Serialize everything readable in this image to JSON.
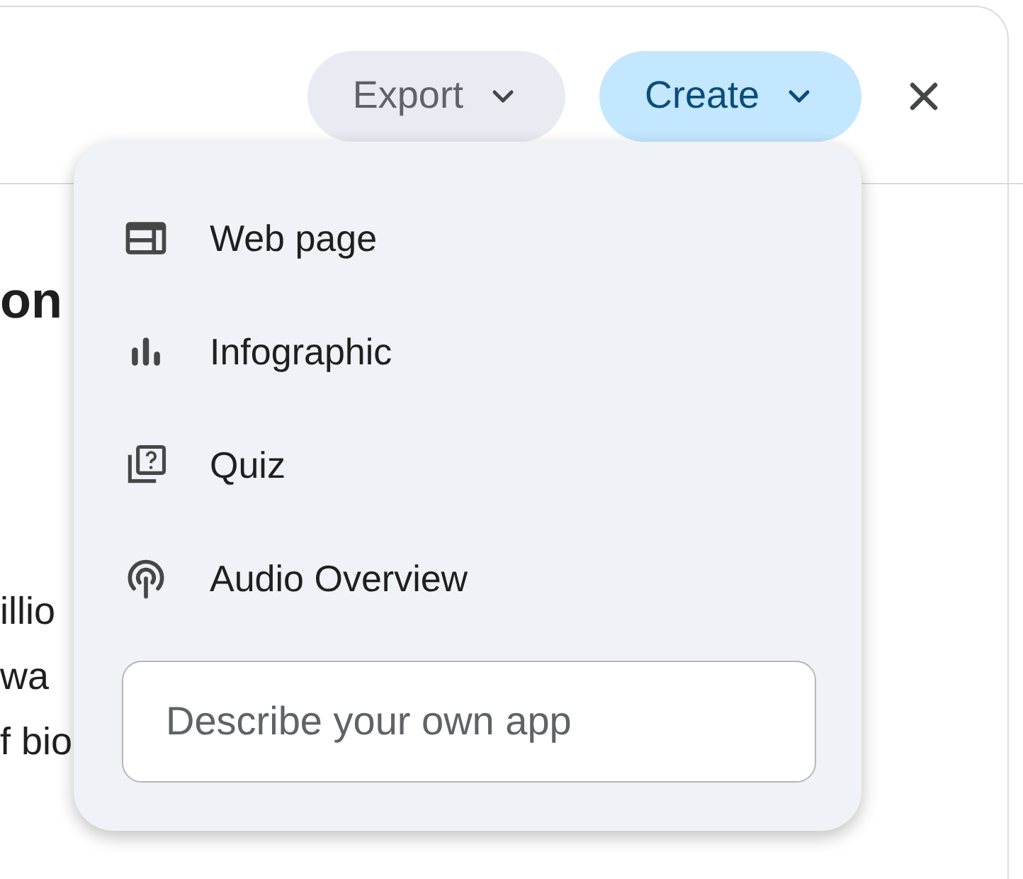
{
  "toolbar": {
    "export": {
      "label": "Export"
    },
    "create": {
      "label": "Create",
      "selected": true
    }
  },
  "document": {
    "heading": "on",
    "lines": [
      "illio",
      "wa",
      "f bio"
    ]
  },
  "menu": {
    "items": [
      {
        "kind": "web",
        "label": "Web page"
      },
      {
        "kind": "chart",
        "label": "Infographic"
      },
      {
        "kind": "quiz",
        "label": "Quiz"
      },
      {
        "kind": "audio",
        "label": "Audio Overview"
      }
    ],
    "input": {
      "placeholder": "Describe your own app"
    }
  }
}
